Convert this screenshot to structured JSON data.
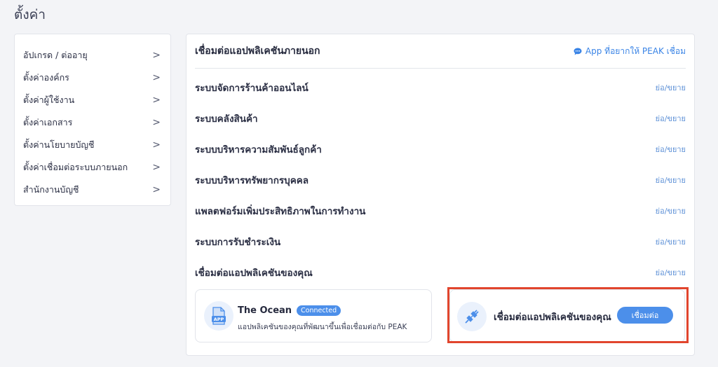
{
  "page": {
    "title": "ตั้งค่า"
  },
  "sidebar": {
    "items": [
      {
        "label": "อัปเกรด / ต่ออายุ"
      },
      {
        "label": "ตั้งค่าองค์กร"
      },
      {
        "label": "ตั้งค่าผู้ใช้งาน"
      },
      {
        "label": "ตั้งค่าเอกสาร"
      },
      {
        "label": "ตั้งค่านโยบายบัญชี"
      },
      {
        "label": "ตั้งค่าเชื่อมต่อระบบภายนอก"
      },
      {
        "label": "สำนักงานบัญชี"
      }
    ],
    "chevron": ">"
  },
  "main": {
    "title": "เชื่อมต่อแอปพลิเคชันภายนอก",
    "app_link": "App ที่อยากให้ PEAK เชื่อม",
    "toggle_label": "ย่อ/ขยาย",
    "categories": [
      {
        "label": "ระบบจัดการร้านค้าออนไลน์"
      },
      {
        "label": "ระบบคลังสินค้า"
      },
      {
        "label": "ระบบบริหารความสัมพันธ์ลูกค้า"
      },
      {
        "label": "ระบบบริหารทรัพยากรบุคคล"
      },
      {
        "label": "แพลตฟอร์มเพิ่มประสิทธิภาพในการทำงาน"
      },
      {
        "label": "ระบบการรับชำระเงิน"
      },
      {
        "label": "เชื่อมต่อแอปพลิเคชันของคุณ"
      }
    ],
    "ocean_card": {
      "title": "The Ocean",
      "badge": "Connected",
      "description": "แอปพลิเคชันของคุณที่พัฒนาขึ้นเพื่อเชื่อมต่อกับ PEAK",
      "icon_text": "APP"
    },
    "connect_card": {
      "title": "เชื่อมต่อแอปพลิเคชันของคุณ",
      "button": "เชื่อมต่อ"
    }
  },
  "colors": {
    "accent": "#4c8fea",
    "highlight": "#e1452d",
    "link": "#3a84e6"
  },
  "icons": {
    "app_link": "chat-bubble-icon",
    "ocean": "app-document-icon",
    "connect": "plug-icon",
    "chevron": "chevron-right-icon"
  }
}
